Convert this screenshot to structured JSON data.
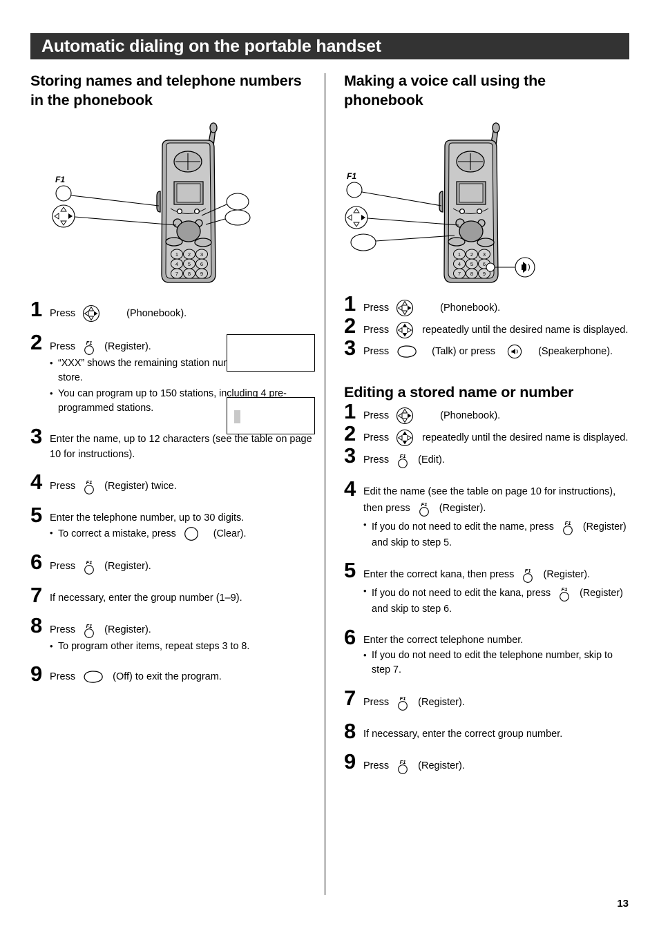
{
  "header": {
    "title": "Automatic dialing on the portable handset"
  },
  "page_number": "13",
  "icons": {
    "nav_phonebook": "nav-pad-right-icon",
    "nav_updown": "nav-pad-updown-icon",
    "f1": "f1-soft-key-icon",
    "talk": "talk-key-icon",
    "off": "off-key-icon",
    "clear": "clear-key-icon",
    "speakerphone": "speakerphone-key-icon",
    "f1_label": "F1"
  },
  "left": {
    "heading": "Storing names and telephone numbers in the phonebook",
    "handset_caption": "portable handset illustration with F1, navigator, Talk and Off keys",
    "steps": [
      {
        "num": "1",
        "pre": "Press",
        "icon": "nav_phonebook",
        "post": "(Phonebook)."
      },
      {
        "num": "2",
        "pre": "Press",
        "icon": "f1",
        "post": "(Register).",
        "subs": [
          "“XXX” shows the remaining station numbers you can store.",
          "You can program up to 150 stations, including 4 pre-programmed stations."
        ]
      },
      {
        "num": "3",
        "text": "Enter the name, up to 12 characters (see the table on page 10 for instructions)."
      },
      {
        "num": "4",
        "pre": "Press",
        "icon": "f1",
        "post": "(Register) twice."
      },
      {
        "num": "5",
        "text": "Enter the telephone number, up to 30 digits.",
        "subs_icon": [
          {
            "pre": "To correct a mistake, press",
            "icon": "clear",
            "post": "(Clear)."
          }
        ]
      },
      {
        "num": "6",
        "pre": "Press",
        "icon": "f1",
        "post": "(Register)."
      },
      {
        "num": "7",
        "text": "If necessary, enter the group number (1–9)."
      },
      {
        "num": "8",
        "pre": "Press",
        "icon": "f1",
        "post": "(Register).",
        "subs": [
          "To program other items, repeat steps 3 to 8."
        ]
      },
      {
        "num": "9",
        "pre": "Press",
        "icon": "off",
        "post": "(Off) to exit the program."
      }
    ],
    "lcd_boxes": [
      {
        "name": "display-callout-1",
        "content": ""
      },
      {
        "name": "display-callout-2",
        "content": ""
      }
    ]
  },
  "right": {
    "heading_voice": "Making a voice call using the phonebook",
    "heading_edit": "Editing a stored name or number",
    "handset_caption": "portable handset illustration with F1, navigator, Talk and Speakerphone keys",
    "voice_steps": [
      {
        "num": "1",
        "pre": "Press",
        "icon": "nav_phonebook",
        "post": "(Phonebook)."
      },
      {
        "num": "2",
        "pre": "Press",
        "icon": "nav_updown",
        "post": "repeatedly until the desired name is displayed."
      },
      {
        "num": "3",
        "pre": "Press",
        "icon": "talk",
        "post": "(Talk) or press",
        "icon2": "speakerphone",
        "post2": "(Speakerphone)."
      }
    ],
    "edit_steps": [
      {
        "num": "1",
        "pre": "Press",
        "icon": "nav_phonebook",
        "post": "(Phonebook)."
      },
      {
        "num": "2",
        "pre": "Press",
        "icon": "nav_updown",
        "post": "repeatedly until the desired name is displayed."
      },
      {
        "num": "3",
        "pre": "Press",
        "icon": "f1",
        "post": "(Edit)."
      },
      {
        "num": "4",
        "pre": "Edit the name (see the table on page 10 for instructions), then press",
        "icon": "f1",
        "post": "(Register).",
        "sub_pre": "If you do not need to edit the name, press",
        "sub_icon": "f1",
        "sub_post": "(Register) and skip to step 5."
      },
      {
        "num": "5",
        "pre": "Enter the correct kana, then press",
        "icon": "f1",
        "post": "(Register).",
        "sub_pre": "If you do not need to edit the kana, press",
        "sub_icon": "f1",
        "sub_post": "(Register) and skip to step 6."
      },
      {
        "num": "6",
        "text": "Enter the correct telephone number.",
        "subs": [
          "If you do not need to edit the telephone number, skip to step 7."
        ]
      },
      {
        "num": "7",
        "pre": "Press",
        "icon": "f1",
        "post": "(Register)."
      },
      {
        "num": "8",
        "text": "If necessary, enter the correct group number."
      },
      {
        "num": "9",
        "pre": "Press",
        "icon": "f1",
        "post": "(Register)."
      }
    ]
  },
  "colors": {
    "header_bg": "#333333",
    "header_text": "#ffffff",
    "body_text": "#000000",
    "handset_body": "#b0b0b0",
    "handset_dark": "#8a8a8a",
    "lcd_cursor": "#c8c8c8"
  }
}
